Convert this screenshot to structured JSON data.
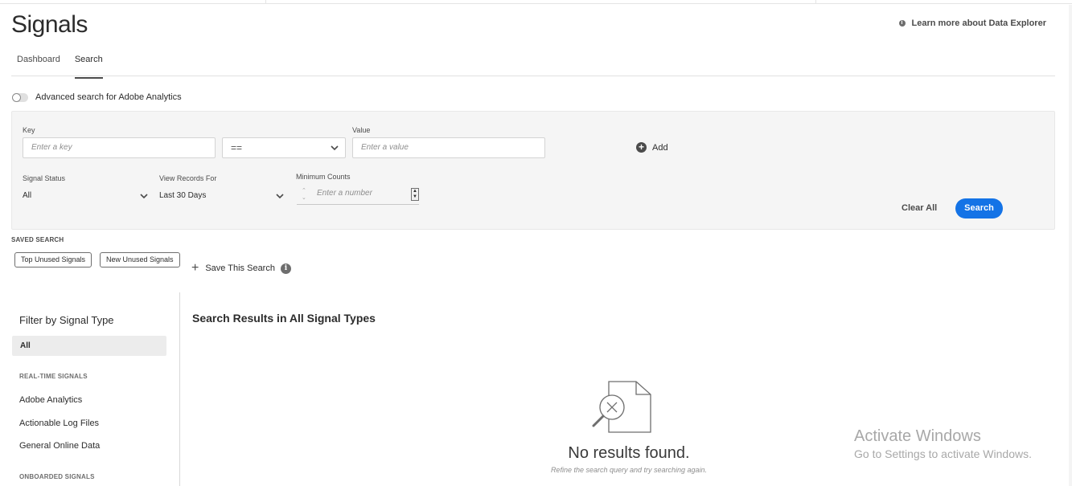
{
  "page": {
    "title": "Signals",
    "learn_more": "Learn more about Data Explorer"
  },
  "tabs": [
    {
      "label": "Dashboard",
      "active": false
    },
    {
      "label": "Search",
      "active": true
    }
  ],
  "advanced_toggle": {
    "label": "Advanced search for Adobe Analytics",
    "on": false
  },
  "search_form": {
    "key_label": "Key",
    "key_placeholder": "Enter a key",
    "operator_value": "==",
    "value_label": "Value",
    "value_placeholder": "Enter a value",
    "add_label": "Add",
    "signal_status_label": "Signal Status",
    "signal_status_value": "All",
    "view_records_label": "View Records For",
    "view_records_value": "Last 30 Days",
    "min_counts_label": "Minimum Counts",
    "min_counts_placeholder": "Enter a number",
    "clear_all_label": "Clear All",
    "search_label": "Search"
  },
  "saved_search": {
    "title": "SAVED SEARCH",
    "chips": [
      "Top Unused Signals",
      "New Unused Signals"
    ],
    "save_label": "Save This Search"
  },
  "filter_panel": {
    "title": "Filter by Signal Type",
    "all_label": "All",
    "realtime_heading": "REAL-TIME SIGNALS",
    "realtime_items": [
      "Adobe Analytics",
      "Actionable Log Files",
      "General Online Data"
    ],
    "onboarded_heading": "ONBOARDED SIGNALS"
  },
  "results": {
    "title": "Search Results in All Signal Types",
    "empty_title": "No results found.",
    "empty_subtitle": "Refine the search query and try searching again."
  },
  "watermark": {
    "line1": "Activate Windows",
    "line2": "Go to Settings to activate Windows."
  },
  "colors": {
    "accent": "#1473e6",
    "panel_bg": "#f5f5f5",
    "text": "#2c2c2c"
  },
  "icons": [
    "info-icon",
    "chevron-down-icon",
    "add-circle-icon",
    "plus-icon",
    "no-results-document-icon"
  ]
}
